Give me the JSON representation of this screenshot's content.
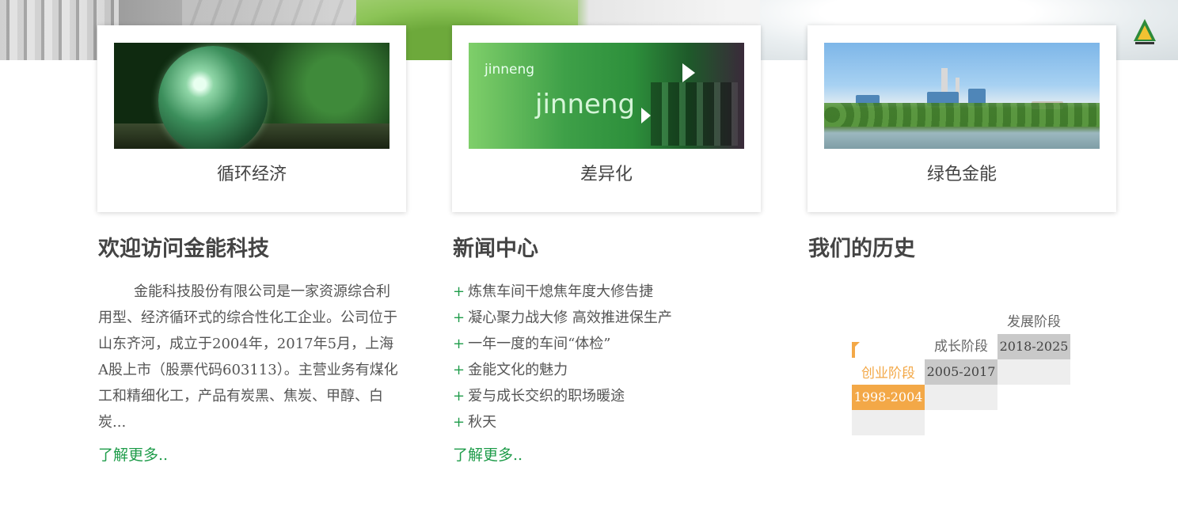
{
  "cards": [
    {
      "label": "循环经济"
    },
    {
      "label": "差异化",
      "image_texts": [
        "jinneng",
        "jinneng"
      ]
    },
    {
      "label": "绿色金能"
    }
  ],
  "about": {
    "title": "欢迎访问金能科技",
    "text": "金能科技股份有限公司是一家资源综合利用型、经济循环式的综合性化工企业。公司位于山东齐河，成立于2004年，2017年5月，上海A股上市（股票代码603113）。主营业务有煤化工和精细化工，产品有炭黑、焦炭、甲醇、白炭...",
    "more": "了解更多.."
  },
  "news": {
    "title": "新闻中心",
    "bullet": "+",
    "items": [
      "炼焦车间干熄焦年度大修告捷",
      "凝心聚力战大修 高效推进保生产",
      "一年一度的车间“体检”",
      "金能文化的魅力",
      "爱与成长交织的职场暖途",
      "秋天"
    ],
    "more": "了解更多.."
  },
  "history": {
    "title": "我们的历史",
    "stages": [
      {
        "name": "创业阶段",
        "years": "1998-2004"
      },
      {
        "name": "成长阶段",
        "years": "2005-2017"
      },
      {
        "name": "发展阶段",
        "years": "2018-2025"
      }
    ]
  },
  "colors": {
    "accent_green": "#1f9c4a",
    "history_orange": "#f3a847",
    "history_gray": "#c9c9c9",
    "history_light": "#eeeeee"
  }
}
